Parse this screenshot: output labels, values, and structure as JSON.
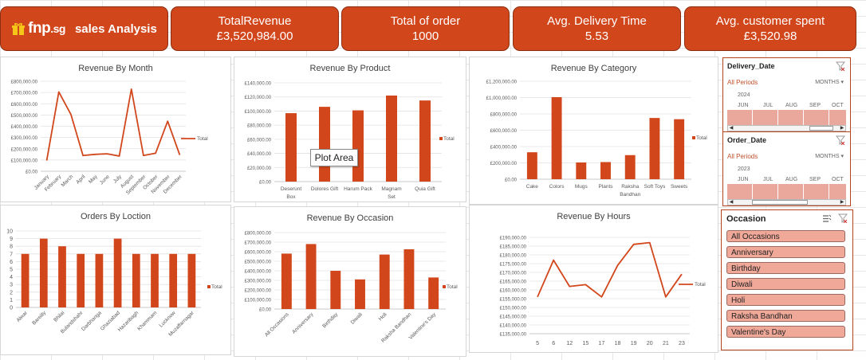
{
  "brand": {
    "logo": "fnp.sg",
    "logo_main": "fnp",
    "logo_tld": ".sg",
    "title": "sales Analysis"
  },
  "kpis": [
    {
      "title": "TotalRevenue",
      "value": "£3,520,984.00"
    },
    {
      "title": "Total of order",
      "value": "1000"
    },
    {
      "title": "Avg. Delivery Time",
      "value": "5.53"
    },
    {
      "title": "Avg. customer spent",
      "value": "£3,520.98"
    }
  ],
  "colors": {
    "accent": "#d2461b",
    "line": "#d2461b",
    "slicer_fill": "#f0a899",
    "timeline_band": "#e9a89b"
  },
  "tooltip": "Plot Area",
  "chart_data": [
    {
      "id": "revenue_by_month",
      "type": "line",
      "title": "Revenue By Month",
      "categories": [
        "January",
        "February",
        "March",
        "April",
        "May",
        "June",
        "July",
        "August",
        "September",
        "October",
        "November",
        "December"
      ],
      "series": [
        {
          "name": "Total",
          "values": [
            95000,
            705000,
            505000,
            140000,
            150000,
            155000,
            135000,
            730000,
            140000,
            160000,
            445000,
            145000
          ]
        }
      ],
      "ylim": [
        0,
        800000
      ],
      "yticks": [
        0,
        100000,
        200000,
        300000,
        400000,
        500000,
        600000,
        700000,
        800000
      ],
      "ytick_labels": [
        "£0.00",
        "£100,000.00",
        "£200,000.00",
        "£300,000.00",
        "£400,000.00",
        "£500,000.00",
        "£600,000.00",
        "£700,000.00",
        "£800,000.00"
      ],
      "legend": "right",
      "grid": true
    },
    {
      "id": "revenue_by_product",
      "type": "bar",
      "title": "Revenue By Product",
      "categories": [
        "Deserunt Box",
        "Dolores Gift",
        "Harum Pack",
        "Magnam Set",
        "Quia Gift"
      ],
      "category_lines": [
        [
          "Deserunt",
          "Box"
        ],
        [
          "Dolores Gift"
        ],
        [
          "Harum Pack"
        ],
        [
          "Magnam",
          "Set"
        ],
        [
          "Quia Gift"
        ]
      ],
      "series": [
        {
          "name": "Total",
          "values": [
            97000,
            106000,
            101000,
            122000,
            115000
          ]
        }
      ],
      "ylim": [
        0,
        140000
      ],
      "yticks": [
        0,
        20000,
        40000,
        60000,
        80000,
        100000,
        120000,
        140000
      ],
      "ytick_labels": [
        "£0.00",
        "£20,000.00",
        "£40,000.00",
        "£60,000.00",
        "£80,000.00",
        "£100,000.00",
        "£120,000.00",
        "£140,000.00"
      ],
      "legend": "right",
      "grid": true
    },
    {
      "id": "revenue_by_category",
      "type": "bar",
      "title": "Revenue By Category",
      "categories": [
        "Cake",
        "Colors",
        "Mugs",
        "Plants",
        "Raksha Bandhan",
        "Soft Toys",
        "Sweets"
      ],
      "category_lines": [
        [
          "Cake"
        ],
        [
          "Colors"
        ],
        [
          "Mugs"
        ],
        [
          "Plants"
        ],
        [
          "Raksha",
          "Bandhan"
        ],
        [
          "Soft Toys"
        ],
        [
          "Sweets"
        ]
      ],
      "series": [
        {
          "name": "Total",
          "values": [
            330000,
            1005000,
            205000,
            210000,
            295000,
            750000,
            735000
          ]
        }
      ],
      "ylim": [
        0,
        1200000
      ],
      "yticks": [
        0,
        200000,
        400000,
        600000,
        800000,
        1000000,
        1200000
      ],
      "ytick_labels": [
        "£0.00",
        "£200,000.00",
        "£400,000.00",
        "£600,000.00",
        "£800,000.00",
        "£1,000,000.00",
        "£1,200,000.00"
      ],
      "legend": "right",
      "grid": true
    },
    {
      "id": "orders_by_location",
      "type": "bar",
      "title": "Orders By Loction",
      "categories": [
        "Alwar",
        "Bareilly",
        "Bhilai",
        "Bulandshahr",
        "Darbhanga",
        "Ghaziabad",
        "Hazaribagh",
        "Khammam",
        "Lucknow",
        "Muzaffarnagar"
      ],
      "series": [
        {
          "name": "Total",
          "values": [
            7,
            9,
            8,
            7,
            7,
            9,
            7,
            7,
            7,
            7
          ]
        }
      ],
      "ylim": [
        0,
        10
      ],
      "yticks": [
        0,
        1,
        2,
        3,
        4,
        5,
        6,
        7,
        8,
        9,
        10
      ],
      "ytick_labels": [
        "0",
        "1",
        "2",
        "3",
        "4",
        "5",
        "6",
        "7",
        "8",
        "9",
        "10"
      ],
      "legend": "right",
      "grid": true
    },
    {
      "id": "revenue_by_occasion",
      "type": "bar",
      "title": "Revenue By Occasion",
      "categories": [
        "All Occasions",
        "Anniversary",
        "Birthday",
        "Diwali",
        "Holi",
        "Raksha Bandhan",
        "Valentine's Day"
      ],
      "series": [
        {
          "name": "Total",
          "values": [
            580000,
            680000,
            400000,
            310000,
            570000,
            625000,
            330000
          ]
        }
      ],
      "ylim": [
        0,
        800000
      ],
      "yticks": [
        0,
        100000,
        200000,
        300000,
        400000,
        500000,
        600000,
        700000,
        800000
      ],
      "ytick_labels": [
        "£0.00",
        "£100,000.00",
        "£200,000.00",
        "£300,000.00",
        "£400,000.00",
        "£500,000.00",
        "£600,000.00",
        "£700,000.00",
        "£800,000.00"
      ],
      "legend": "right",
      "grid": true
    },
    {
      "id": "revenue_by_hours",
      "type": "line",
      "title": "Revenue By Hours",
      "categories": [
        "5",
        "6",
        "12",
        "15",
        "17",
        "18",
        "19",
        "20",
        "21",
        "23"
      ],
      "series": [
        {
          "name": "Total",
          "values": [
            156000,
            177000,
            162000,
            163000,
            156000,
            174000,
            186000,
            187000,
            156000,
            169000
          ]
        }
      ],
      "ylim": [
        135000,
        190000
      ],
      "yticks": [
        135000,
        140000,
        145000,
        150000,
        155000,
        160000,
        165000,
        170000,
        175000,
        180000,
        185000,
        190000
      ],
      "ytick_labels": [
        "£135,000.00",
        "£140,000.00",
        "£145,000.00",
        "£150,000.00",
        "£155,000.00",
        "£160,000.00",
        "£165,000.00",
        "£170,000.00",
        "£175,000.00",
        "£180,000.00",
        "£185,000.00",
        "£190,000.00"
      ],
      "legend": "right",
      "grid": true
    }
  ],
  "slicers": {
    "delivery": {
      "title": "Delivery_Date",
      "periods": "All Periods",
      "level": "MONTHS",
      "year": "2024",
      "months": [
        "JUN",
        "JUL",
        "AUG",
        "SEP",
        "OCT"
      ]
    },
    "order": {
      "title": "Order_Date",
      "periods": "All Periods",
      "level": "MONTHS",
      "year": "2023",
      "months": [
        "JUN",
        "JUL",
        "AUG",
        "SEP",
        "OCT"
      ]
    },
    "occasion": {
      "title": "Occasion",
      "items": [
        "All Occasions",
        "Anniversary",
        "Birthday",
        "Diwali",
        "Holi",
        "Raksha Bandhan",
        "Valentine's Day"
      ]
    }
  }
}
